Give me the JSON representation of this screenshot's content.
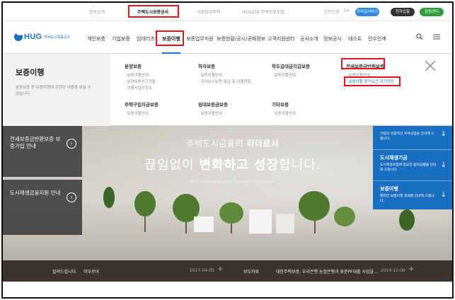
{
  "topbar": {
    "links": [
      "정보공개",
      "주택도시보증공사",
      "사회임대주택",
      "HOUSTA 주택정보포털"
    ],
    "lang_ko": "본인인증",
    "lang_en": "En",
    "btn_blue": "모바일서비스",
    "btn_dark": "전자입찰",
    "btn_green": "알림센터"
  },
  "logo": {
    "mark": "HUG",
    "sub": "주택도시보증공사"
  },
  "nav": {
    "items": [
      "개인보증",
      "기업보증",
      "임대리츠",
      "보증이행",
      "보증업무지원",
      "보증현황/공시/공매정보",
      "고객지원센터",
      "공사소개",
      "정보공시",
      "테스트",
      "인수인계"
    ],
    "search_icon": "search-icon",
    "menu_icon": "hamburger-icon"
  },
  "mega": {
    "title": "보증이행",
    "desc": "분양보증 등 보증이행에 관련된 내용을 보실 수 있습니다.",
    "cols": [
      {
        "head": "분양보증",
        "items": [
          "보증이행안내",
          "분양보증사고현황",
          "이행사업장정보"
        ]
      },
      {
        "head": "하자보증",
        "items": [
          "보증이행안내",
          "하자보수보증 발급 및 이행현황"
        ]
      },
      {
        "head": "하도급대금지급보증",
        "items": [
          "보증이행안내"
        ]
      },
      {
        "head": "전세보증금반환보증",
        "items": [
          "보증이행안내",
          "보증이행 청구요건 자가진단"
        ]
      },
      {
        "head": "주택구입자금보증",
        "items": [
          "보증이행안내"
        ]
      },
      {
        "head": "임대보증금보증",
        "items": [
          "보증이행안내"
        ]
      },
      {
        "head": "기타보증",
        "items": [
          "보증이행안내"
        ]
      }
    ],
    "close_icon": "close-icon"
  },
  "hero": {
    "line1_a": "주택도시금융의 ",
    "line1_b": "리더로서",
    "line2_a": "끊임없이 ",
    "line2_b": "변화하고 성장",
    "line2_c": "합니다.",
    "line3": "Korea Housing & Urban Guarantee Corporation",
    "left_boxes": [
      {
        "label": "전세보증금반환보증 보증가입 안내"
      },
      {
        "label": "도시재생금융지원 안내"
      }
    ],
    "right_boxes": [
      {
        "title": "",
        "desc": "기업의 성공적인 주택사업을 안내해 드립니다."
      },
      {
        "title": "도시재생기금",
        "desc": "도시재생사업에 필요한 융자상품을 안내해 드립니다."
      },
      {
        "title": "보증이행",
        "desc": "편리한 보증이행 정보를 안내해 드립니다."
      }
    ]
  },
  "news": {
    "label1": "알려드립니다.",
    "title1": "이우르어",
    "date1": "2017-04-05",
    "label2": "보도자료",
    "title2": "대한주택보증, 우리은행 농협은행과 표준PF대출 사업을...",
    "date2": "2014-12-09",
    "plus": "+"
  },
  "colors": {
    "accent": "#1a6fc2",
    "highlight": "#e0161b",
    "news_bg": "#3c332d"
  }
}
